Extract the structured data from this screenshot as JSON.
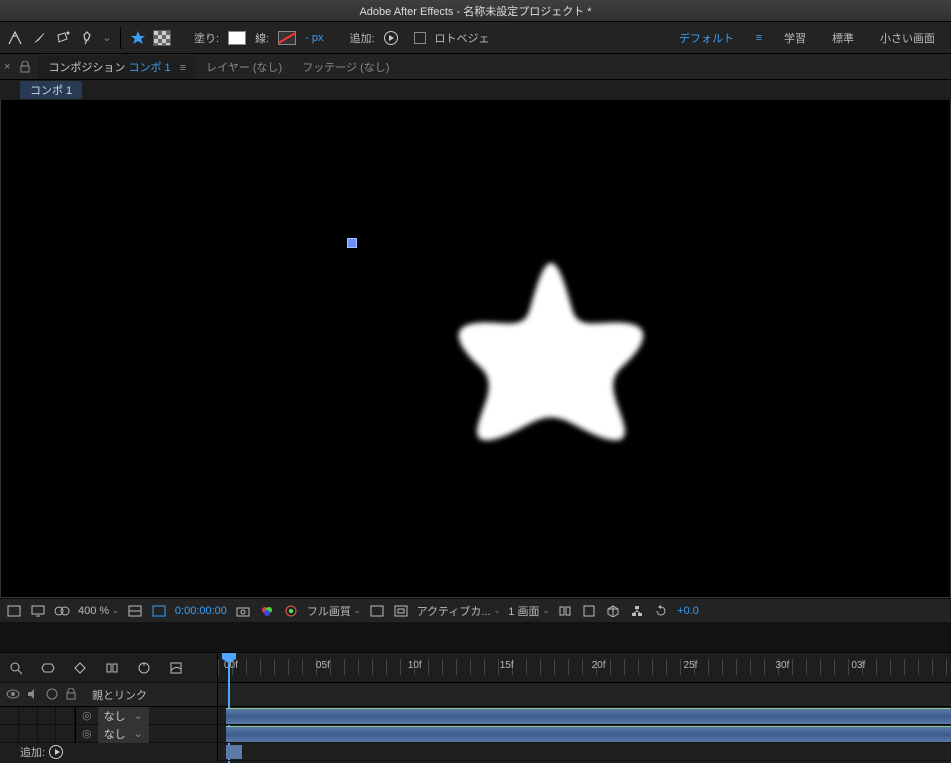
{
  "title": "Adobe After Effects - 名称未設定プロジェクト *",
  "toolbar": {
    "fill_label": "塗り:",
    "stroke_label": "線:",
    "px_label": "- px",
    "add_label": "追加:",
    "rotobezier_label": "ロトベジェ"
  },
  "workspaces": {
    "default": "デフォルト",
    "learn": "学習",
    "standard": "標準",
    "small": "小さい画面"
  },
  "panel_tabs": {
    "composition_prefix": "コンポジション",
    "composition_name": "コンポ 1",
    "layer": "レイヤー (なし)",
    "footage": "フッテージ (なし)"
  },
  "breadcrumb": "コンポ 1",
  "footer": {
    "zoom": "400 %",
    "timecode": "0:00:00:00",
    "quality": "フル画質",
    "camera": "アクティブカ...",
    "views": "1 画面",
    "exposure": "+0.0"
  },
  "timeline": {
    "parent_link_col": "親とリンク",
    "none_value": "なし",
    "add_label": "追加:",
    "ruler_marks": [
      "00f",
      "05f",
      "10f",
      "15f",
      "20f",
      "25f",
      "30f",
      "03f"
    ]
  }
}
